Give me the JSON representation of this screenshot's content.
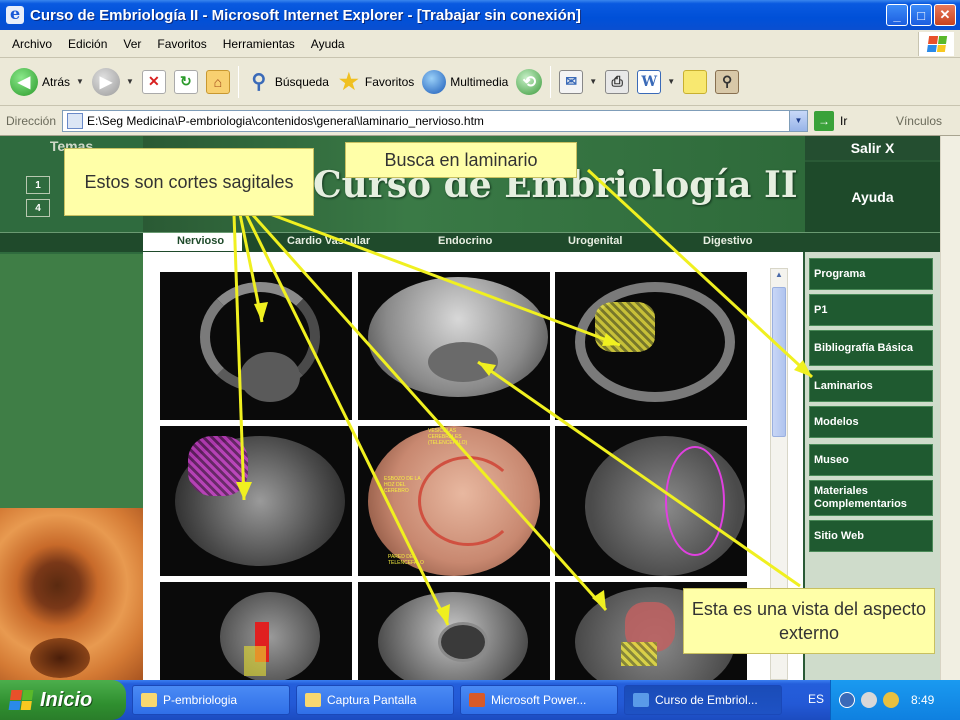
{
  "window": {
    "title": "Curso de Embriología II - Microsoft Internet Explorer - [Trabajar sin conexión]",
    "min": "_",
    "max": "□",
    "close": "✕"
  },
  "menu": [
    "Archivo",
    "Edición",
    "Ver",
    "Favoritos",
    "Herramientas",
    "Ayuda"
  ],
  "toolbar": {
    "back": "Atrás",
    "search": "Búsqueda",
    "favorites": "Favoritos",
    "multimedia": "Multimedia"
  },
  "address": {
    "label": "Dirección",
    "url": "E:\\Seg Medicina\\P-embriologia\\contenidos\\general\\laminario_nervioso.htm",
    "go": "Ir",
    "links": "Vínculos"
  },
  "site": {
    "temas": "Temas",
    "temas_boxes": [
      "1",
      "4"
    ],
    "banner_title": "Curso de Embriología II",
    "salir": "Salir X",
    "ayuda": "Ayuda",
    "tabs": [
      "Nervioso",
      "Cardio Vascular",
      "Endocrino",
      "Urogenital",
      "Digestivo"
    ],
    "right_menu": [
      "Programa",
      "P1",
      "Bibliografía Básica",
      "Laminarios",
      "Modelos",
      "Museo",
      "Materiales Complementarios",
      "Sitio Web"
    ],
    "panel_labels": {
      "vesiculas": "VESICULAS CEREBRALES (TELENCEFALO)",
      "esbozo": "ESBOZO DE LA HOZ DEL CEREBRO",
      "pared": "PARED DEL TELENCEFALO"
    }
  },
  "callouts": {
    "sagitales": "Estos son cortes sagitales",
    "busca": "Busca en laminario",
    "vista": "Esta es una vista del aspecto externo"
  },
  "taskbar": {
    "start": "Inicio",
    "tasks": [
      "P-embriologia",
      "Captura Pantalla",
      "Microsoft Power...",
      "Curso de Embriol..."
    ],
    "lang": "ES",
    "clock": "8:49"
  },
  "colors": {
    "site_green": "#2a5a36",
    "menu_green": "#1f5a30",
    "callout_bg": "#ffffa8",
    "arrow": "#f0f020"
  }
}
